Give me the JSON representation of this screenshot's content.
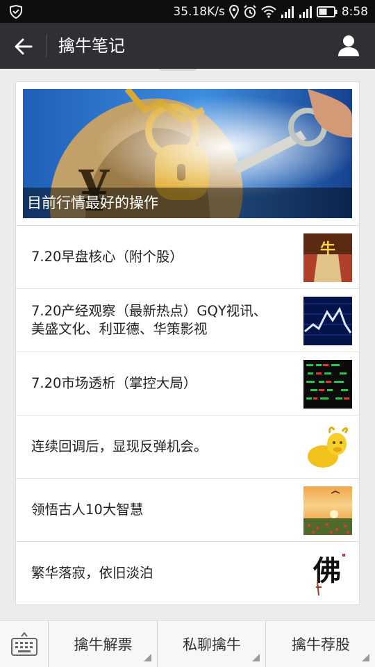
{
  "status_bar": {
    "network_speed": "35.18K/s",
    "time": "8:58",
    "icons": [
      "shield-icon",
      "location-icon",
      "alarm-icon",
      "wifi-icon",
      "signal-icon",
      "signal-icon",
      "battery-icon"
    ]
  },
  "nav": {
    "back_icon": "back-arrow-icon",
    "title": "擒牛笔记",
    "profile_icon": "profile-icon"
  },
  "feed": {
    "cover": {
      "caption": "目前行情最好的操作"
    },
    "articles": [
      {
        "title": "7.20早盘核心（附个股）",
        "thumb": "bull-market-thumbnail"
      },
      {
        "title": "7.20产经观察（最新热点）GQY视讯、美盛文化、利亚德、华策影视",
        "thumb": "stock-chart-thumbnail"
      },
      {
        "title": "7.20市场透析（掌控大局）",
        "thumb": "stock-ticker-board-thumbnail"
      },
      {
        "title": "连续回调后，显现反弹机会。",
        "thumb": "golden-ox-thumbnail"
      },
      {
        "title": "领悟古人10大智慧",
        "thumb": "sunset-field-thumbnail"
      },
      {
        "title": "繁华落寂，依旧淡泊",
        "thumb": "calligraphy-thumbnail"
      }
    ]
  },
  "menu": {
    "keyboard_icon": "keyboard-icon",
    "items": [
      {
        "label": "擒牛解票"
      },
      {
        "label": "私聊擒牛"
      },
      {
        "label": "擒牛荐股"
      }
    ]
  },
  "colors": {
    "status_bar": "#0e0e0e",
    "nav_bar": "#2e3033",
    "page_bg": "#ececec",
    "card_bg": "#ffffff"
  }
}
